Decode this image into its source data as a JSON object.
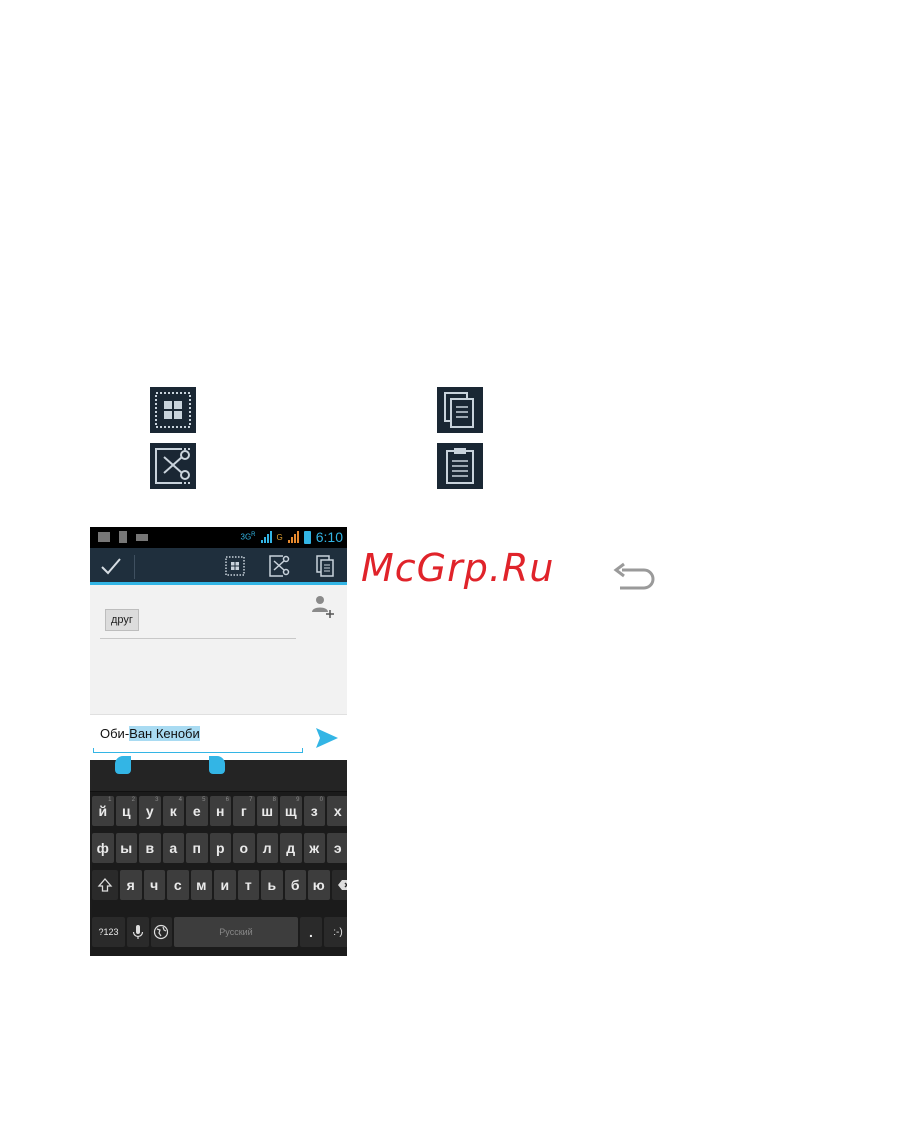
{
  "phone": {
    "status_bar": {
      "net_3g": "3G",
      "net_3g_sup": "R",
      "net_g": "G",
      "time": "6:10"
    },
    "action_bar": {
      "icons": [
        "check-icon",
        "select-all-icon",
        "cut-icon",
        "copy-icon"
      ]
    },
    "recipient_chip": "друг",
    "compose": {
      "text_plain": "Оби-",
      "text_selected": "Ван Кеноби"
    },
    "keyboard": {
      "row1": [
        {
          "k": "й",
          "h": "1"
        },
        {
          "k": "ц",
          "h": "2"
        },
        {
          "k": "у",
          "h": "3"
        },
        {
          "k": "к",
          "h": "4"
        },
        {
          "k": "е",
          "h": "5"
        },
        {
          "k": "н",
          "h": "6"
        },
        {
          "k": "г",
          "h": "7"
        },
        {
          "k": "ш",
          "h": "8"
        },
        {
          "k": "щ",
          "h": "9"
        },
        {
          "k": "з",
          "h": "0"
        },
        {
          "k": "х",
          "h": ""
        }
      ],
      "row2": [
        "ф",
        "ы",
        "в",
        "а",
        "п",
        "р",
        "о",
        "л",
        "д",
        "ж",
        "э"
      ],
      "row3": [
        "я",
        "ч",
        "с",
        "м",
        "и",
        "т",
        "ь",
        "б",
        "ю"
      ],
      "sym_key": "?123",
      "space_label": "Русский",
      "dot_key": ".",
      "smile_key": ":-)"
    }
  },
  "watermark": "McGrp.Ru",
  "colors": {
    "accent": "#33b5e5",
    "action_bar": "#1f2f3d",
    "watermark": "#e0232a",
    "legend_bg": "#1a2734"
  }
}
